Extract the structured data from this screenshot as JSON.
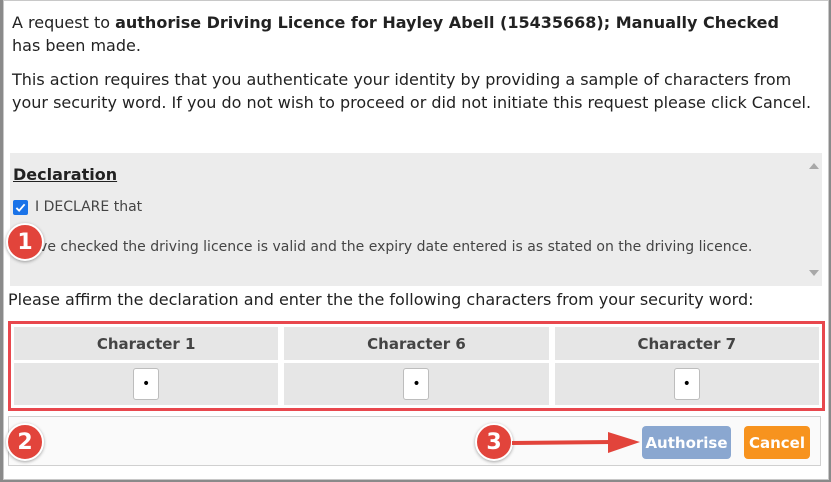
{
  "dialog": {
    "intro_prefix": "A request to ",
    "intro_action": "authorise Driving Licence for Hayley Abell (15435668); Manually Checked",
    "intro_suffix": " has been made.",
    "auth_text": "This action requires that you authenticate your identity by providing a sample of characters from your security word. If you do not wish to proceed or did not initiate this request please click Cancel."
  },
  "declaration": {
    "title": "Declaration",
    "checkbox_label": "I DECLARE that",
    "checked": true,
    "text": "I have checked the driving licence is valid and the expiry date entered is as stated on the driving licence."
  },
  "affirm_text": "Please affirm the declaration and enter the the following characters from your security word:",
  "characters": [
    {
      "label": "Character 1",
      "value": "•"
    },
    {
      "label": "Character 6",
      "value": "•"
    },
    {
      "label": "Character 7",
      "value": "•"
    }
  ],
  "buttons": {
    "authorise": "Authorise",
    "cancel": "Cancel"
  },
  "annotations": {
    "step1": "1",
    "step2": "2",
    "step3": "3"
  },
  "colors": {
    "highlight": "#e8474d",
    "authorise": "#8aa7d0",
    "cancel": "#f7931e",
    "checkbox": "#1a73e8"
  }
}
